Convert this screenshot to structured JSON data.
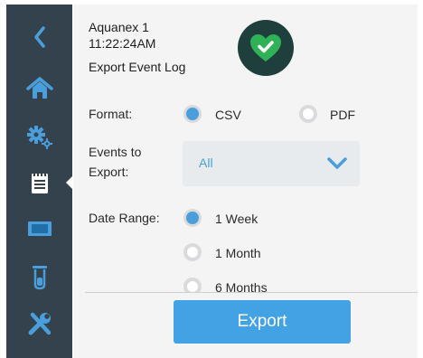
{
  "header": {
    "device_name": "Aquanex 1",
    "time": "11:22:24AM",
    "page_title": "Export Event Log"
  },
  "sidebar": {
    "items": [
      {
        "icon": "chevron-left-icon"
      },
      {
        "icon": "home-icon"
      },
      {
        "icon": "gears-icon"
      },
      {
        "icon": "notepad-icon",
        "active": true
      },
      {
        "icon": "display-icon"
      },
      {
        "icon": "beaker-icon"
      },
      {
        "icon": "tools-icon"
      }
    ]
  },
  "status": {
    "icon": "heart-check-icon",
    "color": "#2fb157"
  },
  "format": {
    "label": "Format:",
    "options": [
      {
        "label": "CSV",
        "selected": true
      },
      {
        "label": "PDF",
        "selected": false
      }
    ]
  },
  "events": {
    "label_line1": "Events to",
    "label_line2": "Export:",
    "selected": "All"
  },
  "date_range": {
    "label": "Date Range:",
    "options": [
      {
        "label": "1 Week",
        "selected": true
      },
      {
        "label": "1 Month",
        "selected": false
      },
      {
        "label": "6 Months",
        "selected": false
      }
    ]
  },
  "footer": {
    "export_label": "Export"
  },
  "colors": {
    "accent": "#43a2e4",
    "sidebar": "#34424d",
    "badge": "#1e3f3c"
  }
}
